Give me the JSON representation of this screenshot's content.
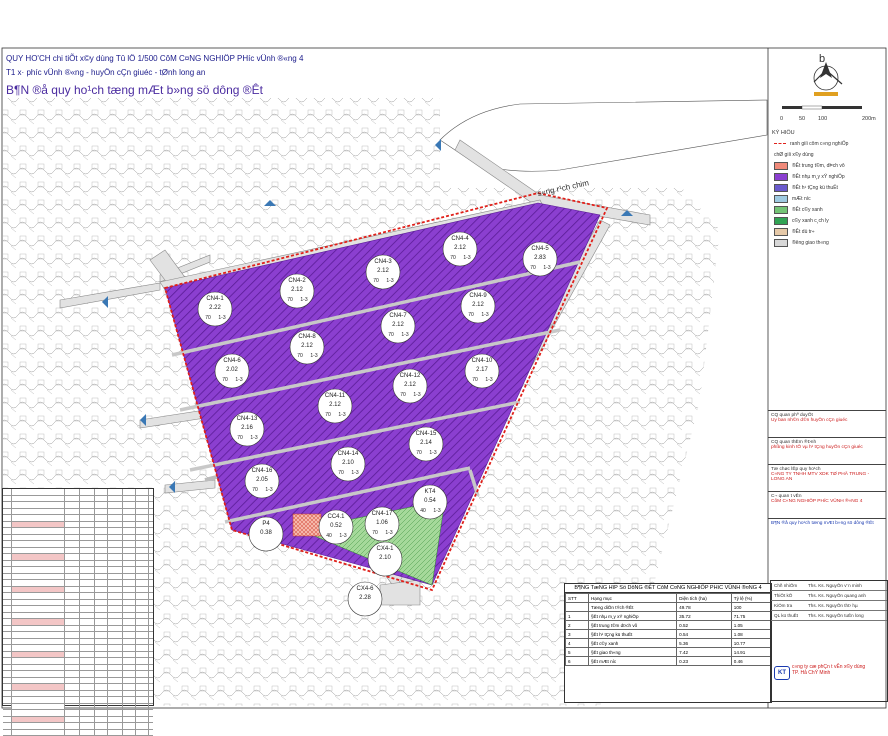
{
  "header": {
    "line1": "QUY HO'CH chi tiÕt x©y dùng Tû lÖ 1/500 CôM C¤NG NGHIÖP PH­íc vÜnh ®«ng 4",
    "line2": "T1 x· ph­íc vÜnh ®«ng - huyÖn cÇn giuéc - tØnh long an",
    "line3": "B¶N ®å quy ho¹ch tæng mÆt b»ng sö dông ®Êt"
  },
  "compass": {
    "letter": "b"
  },
  "scalebar": {
    "labels": [
      "0",
      "50",
      "100",
      "200m"
    ]
  },
  "map": {
    "river_label": "s«ng r¹ch chim",
    "plots": [
      {
        "id": "CN4-1",
        "value": "2.22",
        "rows": [
          "70",
          "1-3"
        ]
      },
      {
        "id": "CN4-2",
        "value": "2.12",
        "rows": [
          "70",
          "1-3"
        ]
      },
      {
        "id": "CN4-3",
        "value": "2.12",
        "rows": [
          "70",
          "1-3"
        ]
      },
      {
        "id": "CN4-4",
        "value": "2.12",
        "rows": [
          "70",
          "1-3"
        ]
      },
      {
        "id": "CN4-5",
        "value": "2.83",
        "rows": [
          "70",
          "1-3"
        ]
      },
      {
        "id": "CN4-6",
        "value": "2.02",
        "rows": [
          "70",
          "1-3"
        ]
      },
      {
        "id": "CN4-7",
        "value": "2.12",
        "rows": [
          "70",
          "1-3"
        ]
      },
      {
        "id": "CN4-8",
        "value": "2.12",
        "rows": [
          "70",
          "1-3"
        ]
      },
      {
        "id": "CN4-9",
        "value": "2.12",
        "rows": [
          "70",
          "1-3"
        ]
      },
      {
        "id": "CN4-10",
        "value": "2.17",
        "rows": [
          "70",
          "1-3"
        ]
      },
      {
        "id": "CN4-11",
        "value": "2.12",
        "rows": [
          "70",
          "1-3"
        ]
      },
      {
        "id": "CN4-12",
        "value": "2.12",
        "rows": [
          "70",
          "1-3"
        ]
      },
      {
        "id": "CN4-13",
        "value": "2.16",
        "rows": [
          "70",
          "1-3"
        ]
      },
      {
        "id": "CN4-14",
        "value": "2.10",
        "rows": [
          "70",
          "1-3"
        ]
      },
      {
        "id": "CN4-15",
        "value": "2.14",
        "rows": [
          "70",
          "1-3"
        ]
      },
      {
        "id": "CN4-16",
        "value": "2.05",
        "rows": [
          "70",
          "1-3"
        ]
      },
      {
        "id": "CN4-17",
        "value": "1.06",
        "rows": [
          "70",
          "1-3"
        ]
      },
      {
        "id": "KT4",
        "value": "0.54",
        "rows": [
          "40",
          "1-3"
        ]
      },
      {
        "id": "CC4.1",
        "value": "0.52",
        "rows": [
          "40",
          "1-3"
        ]
      },
      {
        "id": "P4",
        "value": "0.38",
        "rows": []
      },
      {
        "id": "CX4-1",
        "value": "2.10",
        "rows": []
      },
      {
        "id": "CX4-6",
        "value": "2.28",
        "rows": []
      }
    ],
    "colors": {
      "industry": "#8b3fd0",
      "industry_hatch": "#5a1c96",
      "boundary": "#e0201a",
      "green": "#74c476",
      "road": "#d8d8d8",
      "cc": "#f08a7a"
    }
  },
  "legend": {
    "title": "KÝ HIÖU",
    "boundary": "ranh giíi côm c«ng nghiÖp",
    "section": "chØ giíi x©y dùng",
    "items": [
      {
        "label": "®Êt trung t©m, dÞch vô",
        "color": "#f08a7a"
      },
      {
        "label": "®Êt nhµ m¸y xÝ nghiÖp",
        "color": "#8b3fd0"
      },
      {
        "label": "®Êt h¹ tÇng kü thuËt",
        "color": "#6a5acd"
      },
      {
        "label": "mÆt n­íc",
        "color": "#9ecae1"
      },
      {
        "label": "®Êt c©y xanh",
        "color": "#74c476"
      },
      {
        "label": "c©y xanh c¸ch ly",
        "color": "#31a354"
      },
      {
        "label": "®Êt dù tr÷",
        "color": "#e6c9a8"
      },
      {
        "label": "®­êng giao th«ng",
        "color": "#d8d8d8"
      }
    ]
  },
  "stamps": [
    {
      "label": "CQ quan phª duyÖt",
      "value": "Uy ban nh©n d©n huyÖn cÇn giuéc",
      "cls": "red"
    },
    {
      "label": "CQ quan thÈm ®Þnh",
      "value": "phßng kinh tÕ vµ h¹ tÇng huyÖn cÇn giuéc",
      "cls": "red"
    },
    {
      "label": "Tæ chøc lËp quy ho¹ch",
      "value": "C«NG TY TNHH MTV XDK TØ PHÃ TRUNG - LONG AN",
      "cls": "red"
    },
    {
      "label": "C¬ quan t­ vÊn",
      "value": "CôM C«NG NGHIÖP PH­íC VÜNH ®«NG 4",
      "cls": "red"
    },
    {
      "label": "",
      "value": "B¶N ®å quy ho¹ch tæng mÆt b»ng sö dông ®Êt",
      "cls": "blu"
    }
  ],
  "landuse": {
    "title": "B¶NG TæNG HîP Sö DôNG ®ÊT CôM C¤NG NGHIÖP PH­íC VÜNH ®¤NG 4",
    "headers": [
      "STT",
      "Hạng mục",
      "Diện tích (ha)",
      "Tỷ lệ (%)"
    ],
    "rows": [
      [
        "",
        "Tæng diÖn tÝch ®Êt",
        "49.78",
        "100"
      ],
      [
        "1",
        "§Êt nhµ m¸y xÝ nghiÖp",
        "35.72",
        "71.75"
      ],
      [
        "2",
        "§Êt trung t©m dÞch vô",
        "0.52",
        "1.05"
      ],
      [
        "3",
        "§Êt h¹ tÇng kü thuËt",
        "0.54",
        "1.08"
      ],
      [
        "4",
        "§Êt c©y xanh",
        "5.36",
        "10.77"
      ],
      [
        "5",
        "§Êt giao th«ng",
        "7.42",
        "14.91"
      ],
      [
        "6",
        "§Êt mÆt n­íc",
        "0.23",
        "0.46"
      ]
    ]
  },
  "signatures": [
    {
      "role": "Chñ nhiÖm",
      "name": "Ths. Ks. NguyÔn v¨n minh"
    },
    {
      "role": "ThiÕt kÕ",
      "name": "Ths. Ks. NguyÔn quang anh"
    },
    {
      "role": "KiÓm tra",
      "name": "Ths. Ks. NguyÔn thÞ hµ"
    },
    {
      "role": "QL kü thuËt",
      "name": "Ths. Ks. NguyÔn tuÊn long"
    }
  ],
  "company": {
    "logo": "KT",
    "line1": "c«ng ty cæ phÇn t­ vÊn x©y dùng",
    "line2": "TP. Hå ChÝ Minh"
  }
}
